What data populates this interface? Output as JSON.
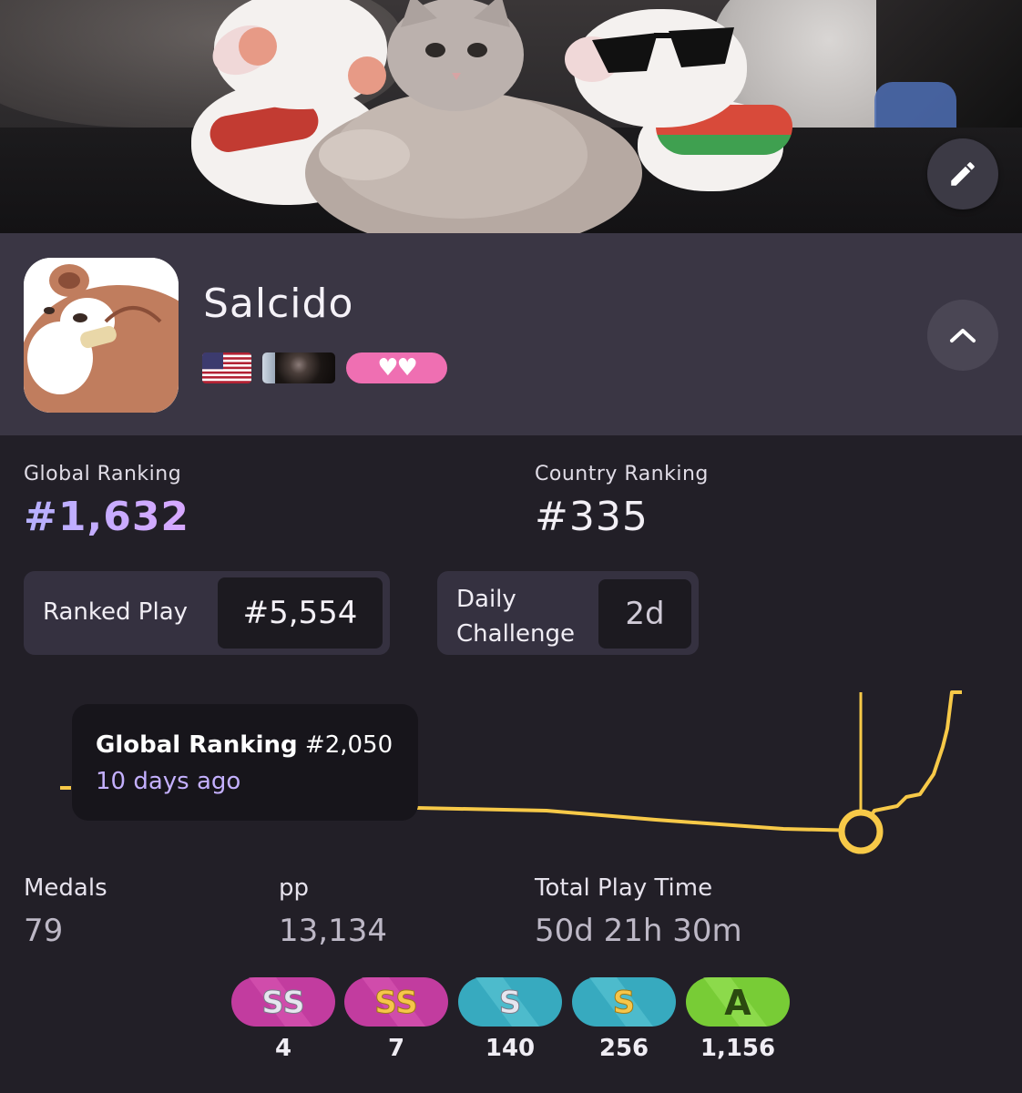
{
  "profile": {
    "username": "Salcido",
    "country_flag": "us-flag-icon",
    "team_flag": "team-flag-icon",
    "supporter_hearts": "♥♥"
  },
  "rankings": {
    "global_label": "Global Ranking",
    "global_value": "#1,632",
    "country_label": "Country Ranking",
    "country_value": "#335"
  },
  "ranked_play": {
    "label": "Ranked Play",
    "value": "#5,554"
  },
  "daily_challenge": {
    "label_line1": "Daily",
    "label_line2": "Challenge",
    "value": "2d"
  },
  "tooltip": {
    "title": "Global Ranking",
    "value": "#2,050",
    "time": "10 days ago"
  },
  "stats": {
    "medals_label": "Medals",
    "medals_value": "79",
    "pp_label": "pp",
    "pp_value": "13,134",
    "playtime_label": "Total Play Time",
    "playtime_value": "50d 21h 30m"
  },
  "grades": [
    {
      "label": "SS",
      "count": "4",
      "kind": "ssh"
    },
    {
      "label": "SS",
      "count": "7",
      "kind": "ss"
    },
    {
      "label": "S",
      "count": "140",
      "kind": "sh"
    },
    {
      "label": "S",
      "count": "256",
      "kind": "s"
    },
    {
      "label": "A",
      "count": "1,156",
      "kind": "a"
    }
  ],
  "colors": {
    "graph_line": "#f7c948",
    "global_rank_gradient": [
      "#b5b0ff",
      "#d8a8ff"
    ],
    "supporter_pink": "#ef6fb2",
    "grade_ssh": "#d23fa8",
    "grade_ss": "#c43da0",
    "grade_sh": "#3fb6c9",
    "grade_s": "#3fb6c9",
    "grade_a": "#7ed13c"
  }
}
